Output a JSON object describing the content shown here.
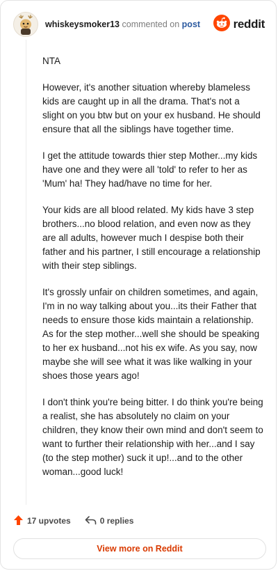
{
  "header": {
    "username": "whiskeysmoker13",
    "action_text": "commented on",
    "post_link": "post",
    "brand": "reddit"
  },
  "icons": {
    "avatar": "deer-antler-avatar-icon",
    "brand_logo": "reddit-alien-icon",
    "upvote": "upvote-arrow-icon",
    "reply": "reply-arrow-icon"
  },
  "colors": {
    "reddit_orange": "#ff4500",
    "upvote_orange": "#ff4500",
    "link_orange": "#d93a00",
    "post_link": "#2c5aa0"
  },
  "comment": {
    "paragraphs": [
      "NTA",
      "However, it's another situation whereby blameless kids are caught up in all the drama. That's not a slight on you btw but on your ex husband. He should ensure that all the siblings have together time.",
      "I get the attitude towards thier step Mother...my kids have one and they were all 'told' to refer to her as 'Mum' ha! They had/have no time for her.",
      "Your kids are all blood related. My kids have 3 step brothers...no blood relation, and even now as they are all adults, however much I despise both their father and his partner, I still encourage a relationship with their step siblings.",
      "It's grossly unfair on children sometimes, and again, I'm in no way talking about you...its their Father that needs to ensure those kids maintain a relationship. As for the step mother...well she should be speaking to her ex husband...not his ex wife. As you say, now maybe she will see what it was like walking in your shoes those years ago!",
      "I don't think you're being bitter. I do think you're being a realist, she has absolutely no claim on your children, they know their own mind and don't seem to want to further their relationship with her...and I say (to the step mother) suck it up!...and to the other woman...good luck!"
    ]
  },
  "actions": {
    "upvotes": "17 upvotes",
    "replies": "0 replies"
  },
  "footer": {
    "view_more": "View more on Reddit"
  }
}
